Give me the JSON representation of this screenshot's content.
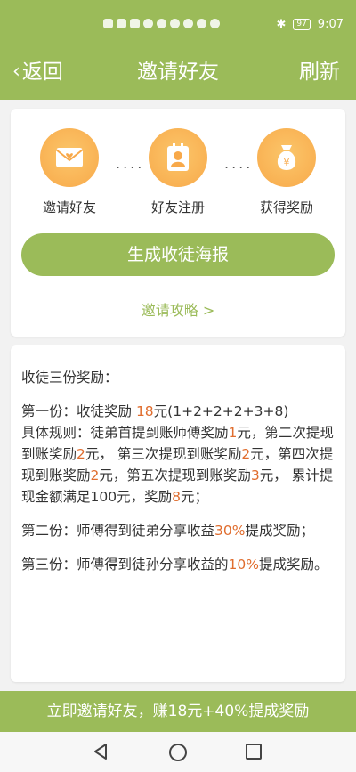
{
  "status_bar": {
    "left_icons": [
      "hd-icon",
      "signal-5g-icon",
      "signal-4g-icon",
      "wifi-icon",
      "app-notification-icon",
      "chat-icon",
      "app-icon",
      "cloud-icon",
      "app-icon"
    ],
    "battery": "97",
    "time": "9:07"
  },
  "header": {
    "back_label": "返回",
    "title": "邀请好友",
    "refresh_label": "刷新"
  },
  "steps": [
    {
      "label": "邀请好友",
      "icon": "envelope-heart-icon"
    },
    {
      "label": "好友注册",
      "icon": "id-card-icon"
    },
    {
      "label": "获得奖励",
      "icon": "money-bag-icon"
    }
  ],
  "dots": "....",
  "poster_button": "生成收徒海报",
  "guide_link": "邀请攻略 >",
  "rewards": {
    "intro": "收徒三份奖励：",
    "first_a": "第一份：收徒奖励 ",
    "first_amount": "18",
    "first_b": "元(1+2+2+2+3+8)",
    "rule_a": "具体规则：徒弟首提到账师傅奖励",
    "rule_v1": "1",
    "rule_b": "元，第二次提现到账奖励",
    "rule_v2": "2",
    "rule_c": "元， 第三次提现到账奖励",
    "rule_v3": "2",
    "rule_d": "元，第四次提现到账奖励",
    "rule_v4": "2",
    "rule_e": "元，第五次提现到账奖励",
    "rule_v5": "3",
    "rule_f": "元， 累计提现金额满足100元，奖励",
    "rule_v6": "8",
    "rule_g": "元；",
    "second_a": "第二份：师傅得到徒弟分享收益",
    "second_pct": "30%",
    "second_b": "提成奖励；",
    "third_a": "第三份：师傅得到徒孙分享收益的",
    "third_pct": "10%",
    "third_b": "提成奖励。"
  },
  "bottom_bar": "立即邀请好友，赚18元+40%提成奖励",
  "colors": {
    "accent": "#9bbb59",
    "highlight": "#e06d2e",
    "icon_orange": "#f8a94a"
  }
}
